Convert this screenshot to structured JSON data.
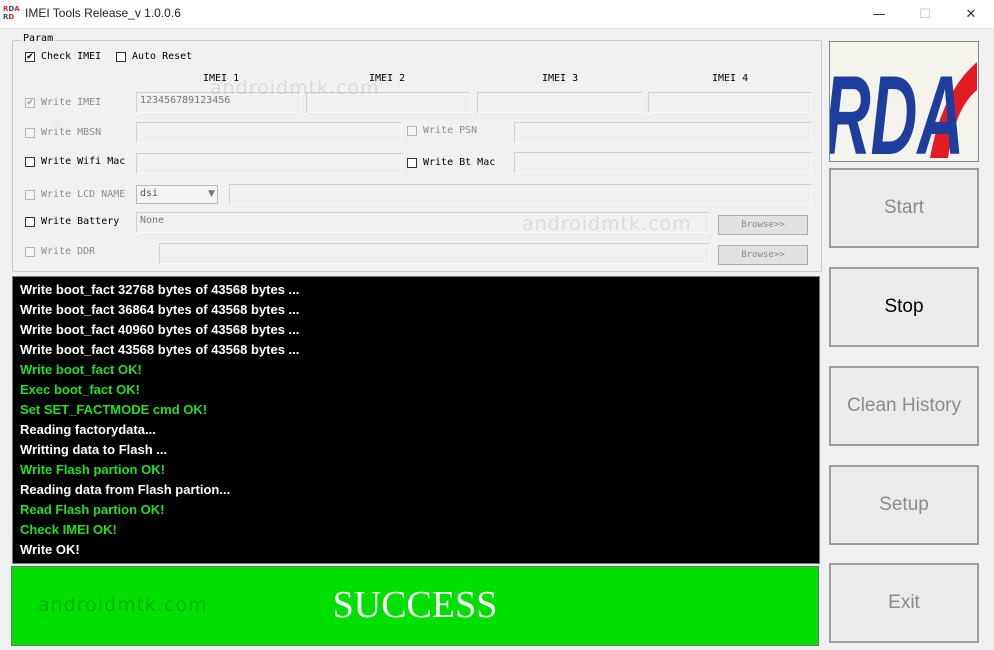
{
  "window": {
    "title": "IMEI Tools Release_v 1.0.0.6",
    "logo_letters": [
      "R",
      "D",
      "A",
      "R",
      "D"
    ],
    "minimize_glyph": "—",
    "maximize_glyph": "☐",
    "close_glyph": "✕"
  },
  "param": {
    "group_label": "Param",
    "check_imei": {
      "label": "Check IMEI",
      "checked": "✔"
    },
    "auto_reset": {
      "label": "Auto Reset"
    },
    "imei_headers": [
      "IMEI 1",
      "IMEI 2",
      "IMEI 3",
      "IMEI 4"
    ],
    "write_imei": {
      "label": "Write IMEI",
      "checked": "✔",
      "values": [
        "123456789123456",
        "",
        "",
        ""
      ]
    },
    "write_mbsn": {
      "label": "Write MBSN",
      "value": ""
    },
    "write_psn": {
      "label": "Write PSN",
      "value": ""
    },
    "write_wifi_mac": {
      "label": "Write Wifi Mac",
      "value": ""
    },
    "write_bt_mac": {
      "label": "Write Bt Mac",
      "value": ""
    },
    "write_lcd_name": {
      "label": "Write LCD NAME",
      "select_value": "dsi",
      "select_arrow": "▼",
      "value": ""
    },
    "write_battery": {
      "label": "Write Battery",
      "value": "None",
      "browse_label": "Browse>>"
    },
    "write_ddr": {
      "label": "Write DDR",
      "value": "",
      "browse_label": "Browse>>"
    }
  },
  "log": {
    "lines": [
      {
        "text": "Write boot_fact 32768 bytes of 43568 bytes ...",
        "color": "#ffffff"
      },
      {
        "text": "Write boot_fact 36864 bytes of 43568 bytes ...",
        "color": "#ffffff"
      },
      {
        "text": "Write boot_fact 40960 bytes of 43568 bytes ...",
        "color": "#ffffff"
      },
      {
        "text": "Write boot_fact 43568 bytes of 43568 bytes ...",
        "color": "#ffffff"
      },
      {
        "text": "Write boot_fact OK!",
        "color": "#1fe01f"
      },
      {
        "text": "Exec boot_fact OK!",
        "color": "#1fe01f"
      },
      {
        "text": "Set SET_FACTMODE cmd OK!",
        "color": "#1fe01f"
      },
      {
        "text": "Reading factorydata...",
        "color": "#ffffff"
      },
      {
        "text": "Writting data to Flash ...",
        "color": "#ffffff"
      },
      {
        "text": "Write Flash partion OK!",
        "color": "#1fe01f"
      },
      {
        "text": "Reading data from Flash partion...",
        "color": "#ffffff"
      },
      {
        "text": "Read Flash partion OK!",
        "color": "#1fe01f"
      },
      {
        "text": "Check IMEI OK!",
        "color": "#1fe01f"
      },
      {
        "text": "Write OK!",
        "color": "#ffffff"
      }
    ]
  },
  "status": {
    "text": "SUCCESS",
    "color": "#00e000"
  },
  "watermark": "androidmtk.com",
  "brand_logo": {
    "text": "RDA",
    "colors": [
      "#1e3e9e",
      "#e41b23"
    ]
  },
  "buttons": {
    "start": "Start",
    "stop": "Stop",
    "clean_history": "Clean History",
    "setup": "Setup",
    "exit": "Exit"
  }
}
